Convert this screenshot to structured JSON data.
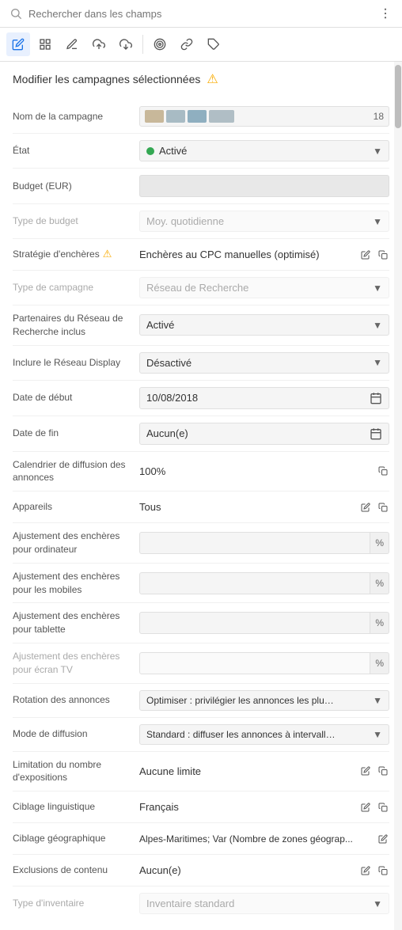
{
  "search": {
    "placeholder": "Rechercher dans les champs"
  },
  "toolbar": {
    "buttons": [
      {
        "name": "edit-pen",
        "symbol": "✏",
        "active": true
      },
      {
        "name": "grid",
        "symbol": "⊞",
        "active": false
      },
      {
        "name": "pencil-alt",
        "symbol": "✎",
        "active": false
      },
      {
        "name": "upload",
        "symbol": "⬆",
        "active": false
      },
      {
        "name": "download",
        "symbol": "⬇",
        "active": false
      },
      {
        "name": "target",
        "symbol": "◎",
        "active": false
      },
      {
        "name": "link",
        "symbol": "🔗",
        "active": false
      },
      {
        "name": "tag",
        "symbol": "🏷",
        "active": false
      }
    ]
  },
  "page": {
    "title": "Modifier les campagnes sélectionnées",
    "warning": "⚠"
  },
  "form": {
    "campaign_name_label": "Nom de la campagne",
    "campaign_name_count": "18",
    "colors": [
      "#c8b89a",
      "#a8bbc4",
      "#8fafc0"
    ],
    "status_label": "État",
    "status_value": "Activé",
    "status_dot_color": "#34a853",
    "budget_label": "Budget (EUR)",
    "budget_type_label": "Type de budget",
    "budget_type_value": "Moy. quotidienne",
    "strategy_label": "Stratégie d'enchères",
    "strategy_warning": "⚠",
    "strategy_value": "Enchères au CPC manuelles (optimisé)",
    "campaign_type_label": "Type de campagne",
    "campaign_type_value": "Réseau de Recherche",
    "search_partners_label": "Partenaires du Réseau de Recherche inclus",
    "search_partners_value": "Activé",
    "display_network_label": "Inclure le Réseau Display",
    "display_network_value": "Désactivé",
    "start_date_label": "Date de début",
    "start_date_value": "10/08/2018",
    "end_date_label": "Date de fin",
    "end_date_value": "Aucun(e)",
    "ad_schedule_label": "Calendrier de diffusion des annonces",
    "ad_schedule_value": "100%",
    "devices_label": "Appareils",
    "devices_value": "Tous",
    "bid_desktop_label": "Ajustement des enchères pour ordinateur",
    "bid_desktop_pct": "%",
    "bid_mobile_label": "Ajustement des enchères pour les mobiles",
    "bid_mobile_pct": "%",
    "bid_tablet_label": "Ajustement des enchères pour tablette",
    "bid_tablet_pct": "%",
    "bid_tv_label": "Ajustement des enchères pour écran TV",
    "bid_tv_pct": "%",
    "rotation_label": "Rotation des annonces",
    "rotation_value": "Optimiser : privilégier les annonces les plus performa...",
    "delivery_label": "Mode de diffusion",
    "delivery_value": "Standard : diffuser les annonces à intervalles régulie...",
    "frequency_label": "Limitation du nombre d'expositions",
    "frequency_value": "Aucune limite",
    "language_label": "Ciblage linguistique",
    "language_value": "Français",
    "geo_label": "Ciblage géographique",
    "geo_value": "Alpes-Maritimes; Var (Nombre de zones géograp...",
    "content_excl_label": "Exclusions de contenu",
    "content_excl_value": "Aucun(e)",
    "inventory_label": "Type d'inventaire",
    "inventory_value": "Inventaire standard"
  }
}
